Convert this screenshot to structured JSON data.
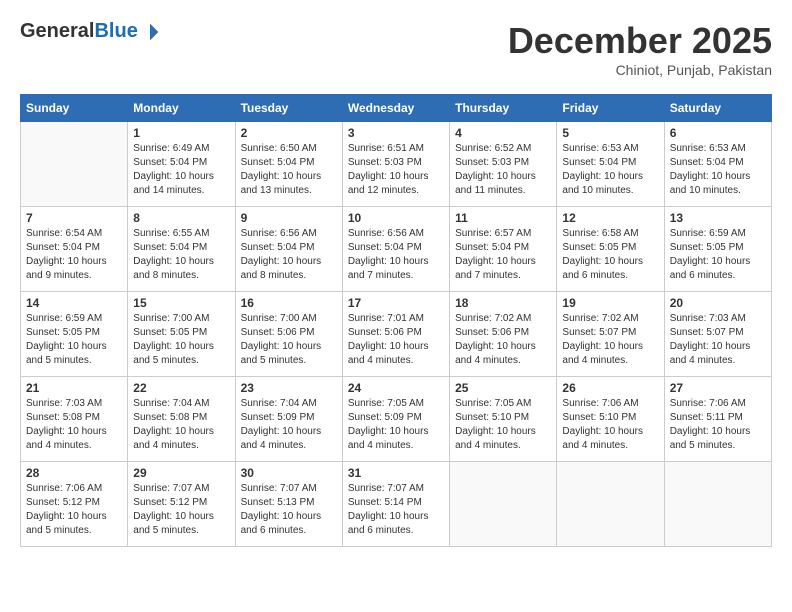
{
  "header": {
    "logo": {
      "general": "General",
      "blue": "Blue"
    },
    "month": "December 2025",
    "location": "Chiniot, Punjab, Pakistan"
  },
  "days_of_week": [
    "Sunday",
    "Monday",
    "Tuesday",
    "Wednesday",
    "Thursday",
    "Friday",
    "Saturday"
  ],
  "weeks": [
    [
      {
        "day": "",
        "info": ""
      },
      {
        "day": "1",
        "info": "Sunrise: 6:49 AM\nSunset: 5:04 PM\nDaylight: 10 hours\nand 14 minutes."
      },
      {
        "day": "2",
        "info": "Sunrise: 6:50 AM\nSunset: 5:04 PM\nDaylight: 10 hours\nand 13 minutes."
      },
      {
        "day": "3",
        "info": "Sunrise: 6:51 AM\nSunset: 5:03 PM\nDaylight: 10 hours\nand 12 minutes."
      },
      {
        "day": "4",
        "info": "Sunrise: 6:52 AM\nSunset: 5:03 PM\nDaylight: 10 hours\nand 11 minutes."
      },
      {
        "day": "5",
        "info": "Sunrise: 6:53 AM\nSunset: 5:04 PM\nDaylight: 10 hours\nand 10 minutes."
      },
      {
        "day": "6",
        "info": "Sunrise: 6:53 AM\nSunset: 5:04 PM\nDaylight: 10 hours\nand 10 minutes."
      }
    ],
    [
      {
        "day": "7",
        "info": "Sunrise: 6:54 AM\nSunset: 5:04 PM\nDaylight: 10 hours\nand 9 minutes."
      },
      {
        "day": "8",
        "info": "Sunrise: 6:55 AM\nSunset: 5:04 PM\nDaylight: 10 hours\nand 8 minutes."
      },
      {
        "day": "9",
        "info": "Sunrise: 6:56 AM\nSunset: 5:04 PM\nDaylight: 10 hours\nand 8 minutes."
      },
      {
        "day": "10",
        "info": "Sunrise: 6:56 AM\nSunset: 5:04 PM\nDaylight: 10 hours\nand 7 minutes."
      },
      {
        "day": "11",
        "info": "Sunrise: 6:57 AM\nSunset: 5:04 PM\nDaylight: 10 hours\nand 7 minutes."
      },
      {
        "day": "12",
        "info": "Sunrise: 6:58 AM\nSunset: 5:05 PM\nDaylight: 10 hours\nand 6 minutes."
      },
      {
        "day": "13",
        "info": "Sunrise: 6:59 AM\nSunset: 5:05 PM\nDaylight: 10 hours\nand 6 minutes."
      }
    ],
    [
      {
        "day": "14",
        "info": "Sunrise: 6:59 AM\nSunset: 5:05 PM\nDaylight: 10 hours\nand 5 minutes."
      },
      {
        "day": "15",
        "info": "Sunrise: 7:00 AM\nSunset: 5:05 PM\nDaylight: 10 hours\nand 5 minutes."
      },
      {
        "day": "16",
        "info": "Sunrise: 7:00 AM\nSunset: 5:06 PM\nDaylight: 10 hours\nand 5 minutes."
      },
      {
        "day": "17",
        "info": "Sunrise: 7:01 AM\nSunset: 5:06 PM\nDaylight: 10 hours\nand 4 minutes."
      },
      {
        "day": "18",
        "info": "Sunrise: 7:02 AM\nSunset: 5:06 PM\nDaylight: 10 hours\nand 4 minutes."
      },
      {
        "day": "19",
        "info": "Sunrise: 7:02 AM\nSunset: 5:07 PM\nDaylight: 10 hours\nand 4 minutes."
      },
      {
        "day": "20",
        "info": "Sunrise: 7:03 AM\nSunset: 5:07 PM\nDaylight: 10 hours\nand 4 minutes."
      }
    ],
    [
      {
        "day": "21",
        "info": "Sunrise: 7:03 AM\nSunset: 5:08 PM\nDaylight: 10 hours\nand 4 minutes."
      },
      {
        "day": "22",
        "info": "Sunrise: 7:04 AM\nSunset: 5:08 PM\nDaylight: 10 hours\nand 4 minutes."
      },
      {
        "day": "23",
        "info": "Sunrise: 7:04 AM\nSunset: 5:09 PM\nDaylight: 10 hours\nand 4 minutes."
      },
      {
        "day": "24",
        "info": "Sunrise: 7:05 AM\nSunset: 5:09 PM\nDaylight: 10 hours\nand 4 minutes."
      },
      {
        "day": "25",
        "info": "Sunrise: 7:05 AM\nSunset: 5:10 PM\nDaylight: 10 hours\nand 4 minutes."
      },
      {
        "day": "26",
        "info": "Sunrise: 7:06 AM\nSunset: 5:10 PM\nDaylight: 10 hours\nand 4 minutes."
      },
      {
        "day": "27",
        "info": "Sunrise: 7:06 AM\nSunset: 5:11 PM\nDaylight: 10 hours\nand 5 minutes."
      }
    ],
    [
      {
        "day": "28",
        "info": "Sunrise: 7:06 AM\nSunset: 5:12 PM\nDaylight: 10 hours\nand 5 minutes."
      },
      {
        "day": "29",
        "info": "Sunrise: 7:07 AM\nSunset: 5:12 PM\nDaylight: 10 hours\nand 5 minutes."
      },
      {
        "day": "30",
        "info": "Sunrise: 7:07 AM\nSunset: 5:13 PM\nDaylight: 10 hours\nand 6 minutes."
      },
      {
        "day": "31",
        "info": "Sunrise: 7:07 AM\nSunset: 5:14 PM\nDaylight: 10 hours\nand 6 minutes."
      },
      {
        "day": "",
        "info": ""
      },
      {
        "day": "",
        "info": ""
      },
      {
        "day": "",
        "info": ""
      }
    ]
  ]
}
